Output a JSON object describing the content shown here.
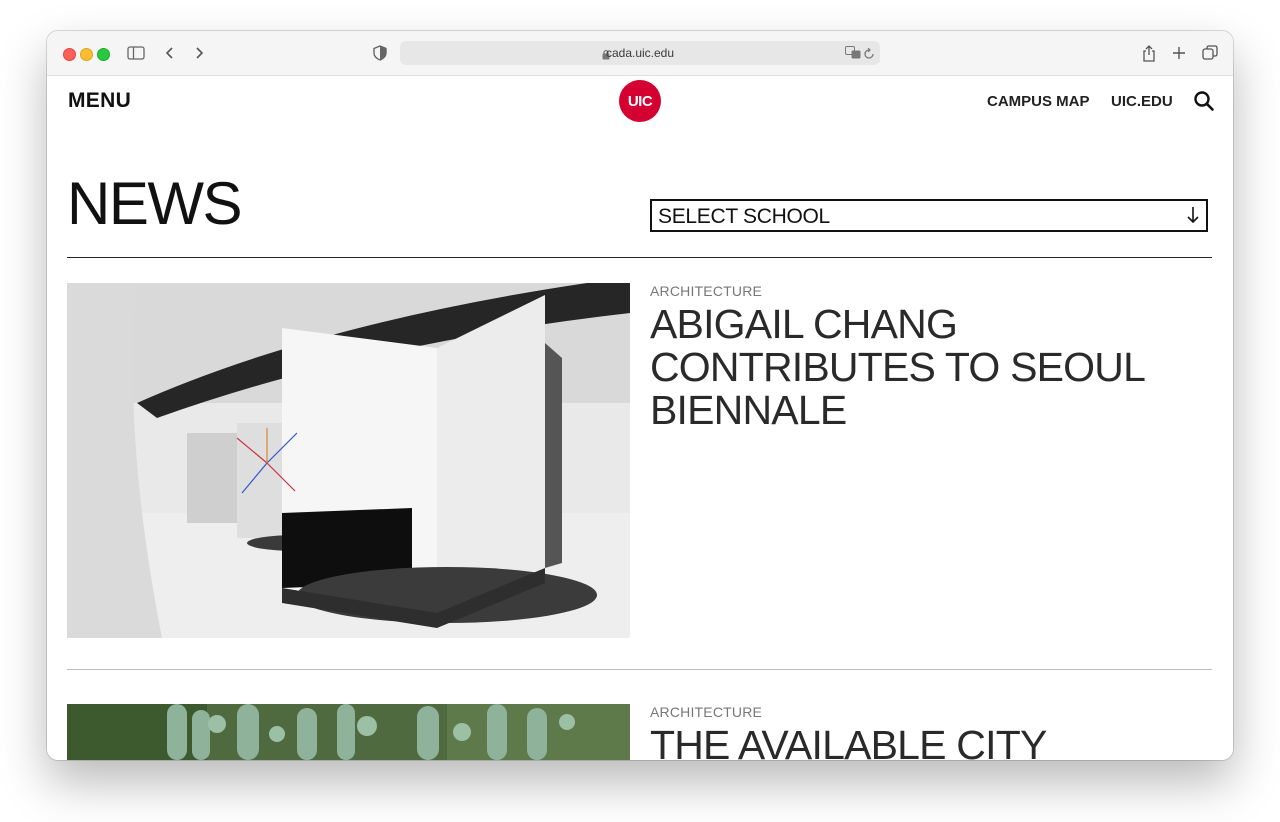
{
  "browser": {
    "url": "cada.uic.edu"
  },
  "site": {
    "menu_label": "MENU",
    "logo_text": "UIC",
    "brand_color": "#d50032",
    "nav": {
      "campus_map": "CAMPUS MAP",
      "uic_edu": "UIC.EDU"
    }
  },
  "news": {
    "title": "NEWS",
    "filter": {
      "selected": "SELECT SCHOOL"
    },
    "articles": [
      {
        "category": "ARCHITECTURE",
        "headline": "ABIGAIL CHANG CONTRIBUTES TO SEOUL BIENNALE"
      },
      {
        "category": "ARCHITECTURE",
        "headline": "THE AVAILABLE CITY"
      }
    ]
  }
}
